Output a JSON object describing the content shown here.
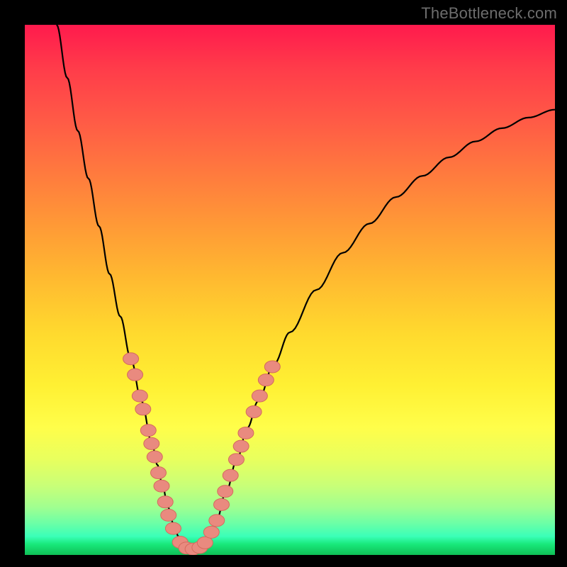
{
  "watermark": "TheBottleneck.com",
  "colors": {
    "frame": "#000000",
    "curve": "#000000",
    "marker_fill": "#e98a7f",
    "marker_stroke": "#d46b5d"
  },
  "chart_data": {
    "type": "line",
    "title": "",
    "xlabel": "",
    "ylabel": "",
    "xlim": [
      0,
      100
    ],
    "ylim": [
      0,
      100
    ],
    "series": [
      {
        "name": "bottleneck-curve",
        "x": [
          6,
          8,
          10,
          12,
          14,
          16,
          18,
          20,
          22,
          24,
          25,
          26,
          27,
          28,
          29,
          30,
          31,
          32,
          33,
          34,
          36,
          38,
          40,
          42,
          44,
          47,
          50,
          55,
          60,
          65,
          70,
          75,
          80,
          85,
          90,
          95,
          100
        ],
        "y": [
          100,
          90,
          80,
          71,
          62,
          53,
          45,
          37,
          29,
          21,
          17,
          13,
          9,
          6,
          3.5,
          2,
          1.2,
          1,
          1.2,
          2,
          6,
          12,
          18,
          24,
          29,
          36,
          42,
          50,
          57,
          62.5,
          67.5,
          71.5,
          75,
          78,
          80.5,
          82.5,
          84
        ]
      }
    ],
    "markers": {
      "name": "highlighted-points",
      "points": [
        {
          "x": 20.0,
          "y": 37
        },
        {
          "x": 20.8,
          "y": 34
        },
        {
          "x": 21.7,
          "y": 30
        },
        {
          "x": 22.3,
          "y": 27.5
        },
        {
          "x": 23.3,
          "y": 23.5
        },
        {
          "x": 23.9,
          "y": 21
        },
        {
          "x": 24.5,
          "y": 18.5
        },
        {
          "x": 25.2,
          "y": 15.5
        },
        {
          "x": 25.8,
          "y": 13
        },
        {
          "x": 26.5,
          "y": 10
        },
        {
          "x": 27.1,
          "y": 7.5
        },
        {
          "x": 28.0,
          "y": 5
        },
        {
          "x": 29.3,
          "y": 2.4
        },
        {
          "x": 30.5,
          "y": 1.3
        },
        {
          "x": 31.7,
          "y": 1.1
        },
        {
          "x": 33.0,
          "y": 1.4
        },
        {
          "x": 34.0,
          "y": 2.3
        },
        {
          "x": 35.2,
          "y": 4.3
        },
        {
          "x": 36.2,
          "y": 6.5
        },
        {
          "x": 37.1,
          "y": 9.5
        },
        {
          "x": 37.8,
          "y": 12
        },
        {
          "x": 38.8,
          "y": 15
        },
        {
          "x": 39.9,
          "y": 18
        },
        {
          "x": 40.8,
          "y": 20.5
        },
        {
          "x": 41.7,
          "y": 23
        },
        {
          "x": 43.2,
          "y": 27
        },
        {
          "x": 44.3,
          "y": 30
        },
        {
          "x": 45.5,
          "y": 33
        },
        {
          "x": 46.7,
          "y": 35.5
        }
      ]
    }
  }
}
